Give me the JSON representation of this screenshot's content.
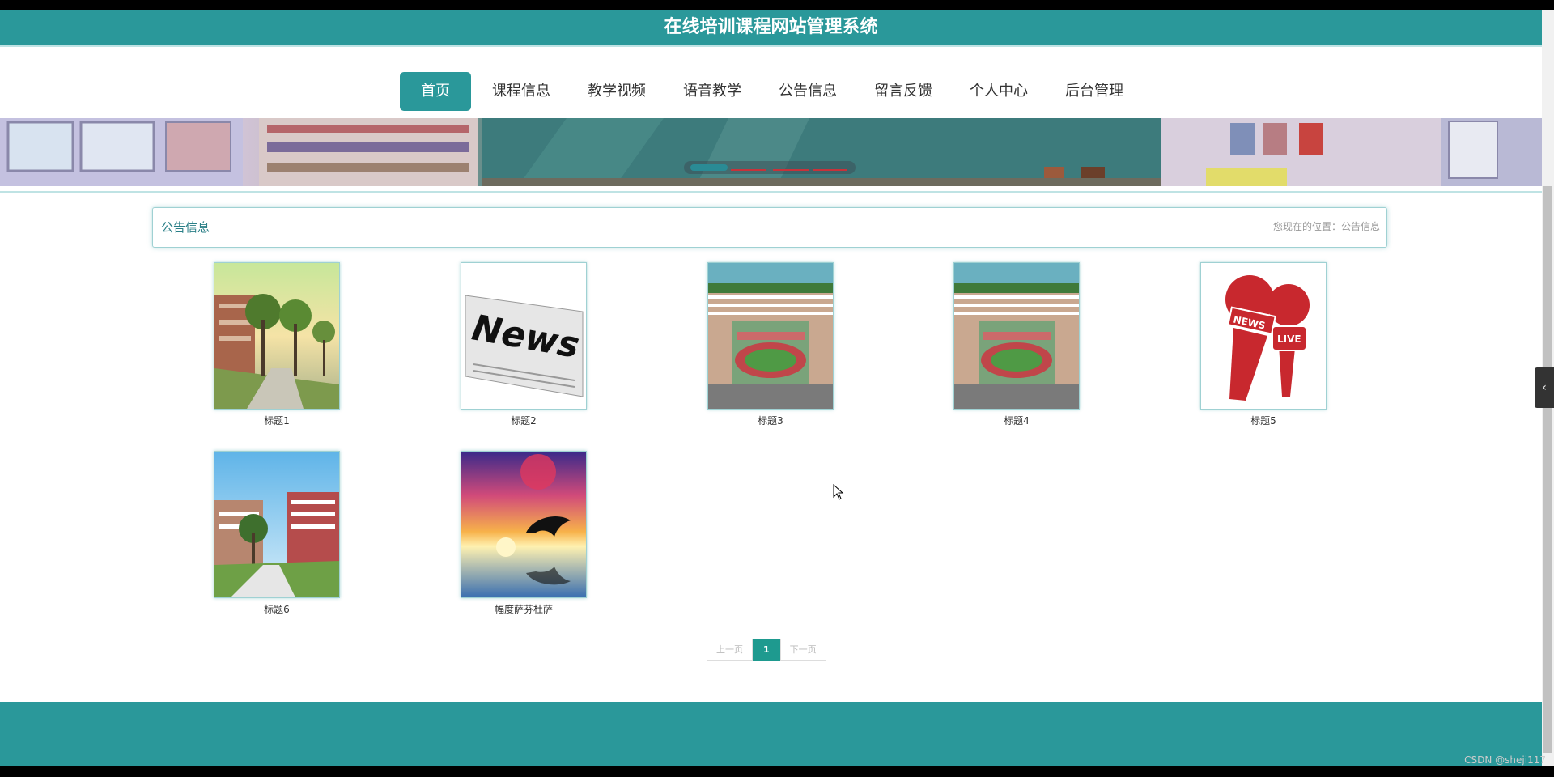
{
  "site": {
    "title": "在线培训课程网站管理系统",
    "accent": "#2a989a"
  },
  "nav": {
    "items": [
      {
        "label": "首页",
        "active": true
      },
      {
        "label": "课程信息"
      },
      {
        "label": "教学视频"
      },
      {
        "label": "语音教学"
      },
      {
        "label": "公告信息"
      },
      {
        "label": "留言反馈"
      },
      {
        "label": "个人中心"
      },
      {
        "label": "后台管理"
      }
    ]
  },
  "banner": {
    "slide_count": 4,
    "active_slide": 1
  },
  "section": {
    "title": "公告信息",
    "breadcrumb": "您现在的位置：公告信息"
  },
  "cards": [
    {
      "caption": "标题1",
      "image": "park-trees"
    },
    {
      "caption": "标题2",
      "image": "newspaper-news"
    },
    {
      "caption": "标题3",
      "image": "campus-aerial"
    },
    {
      "caption": "标题4",
      "image": "campus-aerial"
    },
    {
      "caption": "标题5",
      "image": "news-live-microphones"
    },
    {
      "caption": "标题6",
      "image": "campus-buildings"
    },
    {
      "caption": "幅度萨芬杜萨",
      "image": "dolphin-sunset"
    }
  ],
  "pager": {
    "prev": "上一页",
    "current": "1",
    "next": "下一页"
  },
  "watermark": "CSDN @sheji117"
}
